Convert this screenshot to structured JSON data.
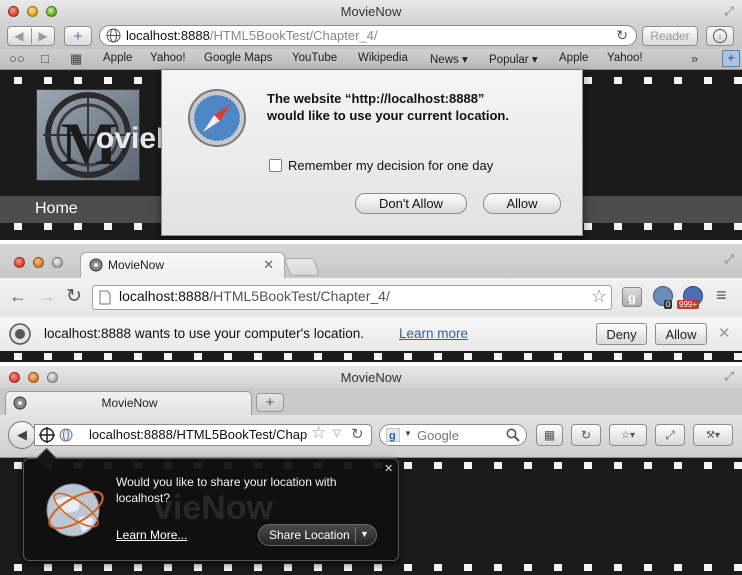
{
  "safari": {
    "window_title": "MovieNow",
    "url_host": "localhost:8888",
    "url_path": "/HTML5BookTest/Chapter_4/",
    "reader_label": "Reader",
    "bookmarks": [
      "Apple",
      "Yahoo!",
      "Google Maps",
      "YouTube",
      "Wikipedia",
      "News ▾",
      "Popular ▾",
      "Apple",
      "Yahoo!"
    ],
    "page": {
      "logo_letter": "M",
      "logo_word": "ovieNow",
      "nav_home": "Home"
    },
    "dialog": {
      "message_line1": "The website “http://localhost:8888”",
      "message_line2": "would like to use your current location.",
      "remember_label": "Remember my decision for one day",
      "dont_allow_label": "Don't Allow",
      "allow_label": "Allow"
    }
  },
  "chrome": {
    "tab_title": "MovieNow",
    "url_host": "localhost:8888",
    "url_path": "/HTML5BookTest/Chapter_4/",
    "badge_count_1": "0",
    "badge_count_2": "999+",
    "infobar_message": "localhost:8888 wants to use your computer's location.",
    "learn_more": "Learn more",
    "deny_label": "Deny",
    "allow_label": "Allow"
  },
  "firefox": {
    "window_title": "MovieNow",
    "tab_title": "MovieNow",
    "url_text": "localhost:8888/HTML5BookTest/Chap",
    "search_engine": "Google",
    "panel": {
      "message_line1": "Would you like to share your location with",
      "message_line2": "localhost?",
      "learn_more": "Learn More...",
      "share_label": "Share Location",
      "watermark": "vieNow"
    }
  }
}
